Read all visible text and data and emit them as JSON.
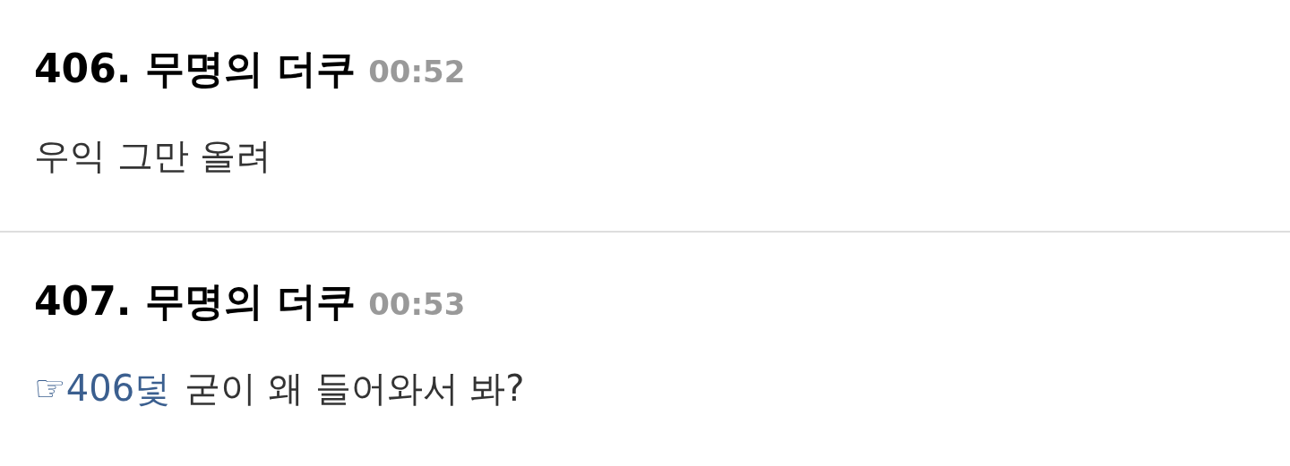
{
  "comments": [
    {
      "number": "406.",
      "author": "무명의 더쿠",
      "time": "00:52",
      "body": "우익 그만 올려"
    },
    {
      "number": "407.",
      "author": "무명의 더쿠",
      "time": "00:53",
      "reply_to": "☞406덫",
      "body": "굳이 왜 들어와서 봐?"
    }
  ]
}
